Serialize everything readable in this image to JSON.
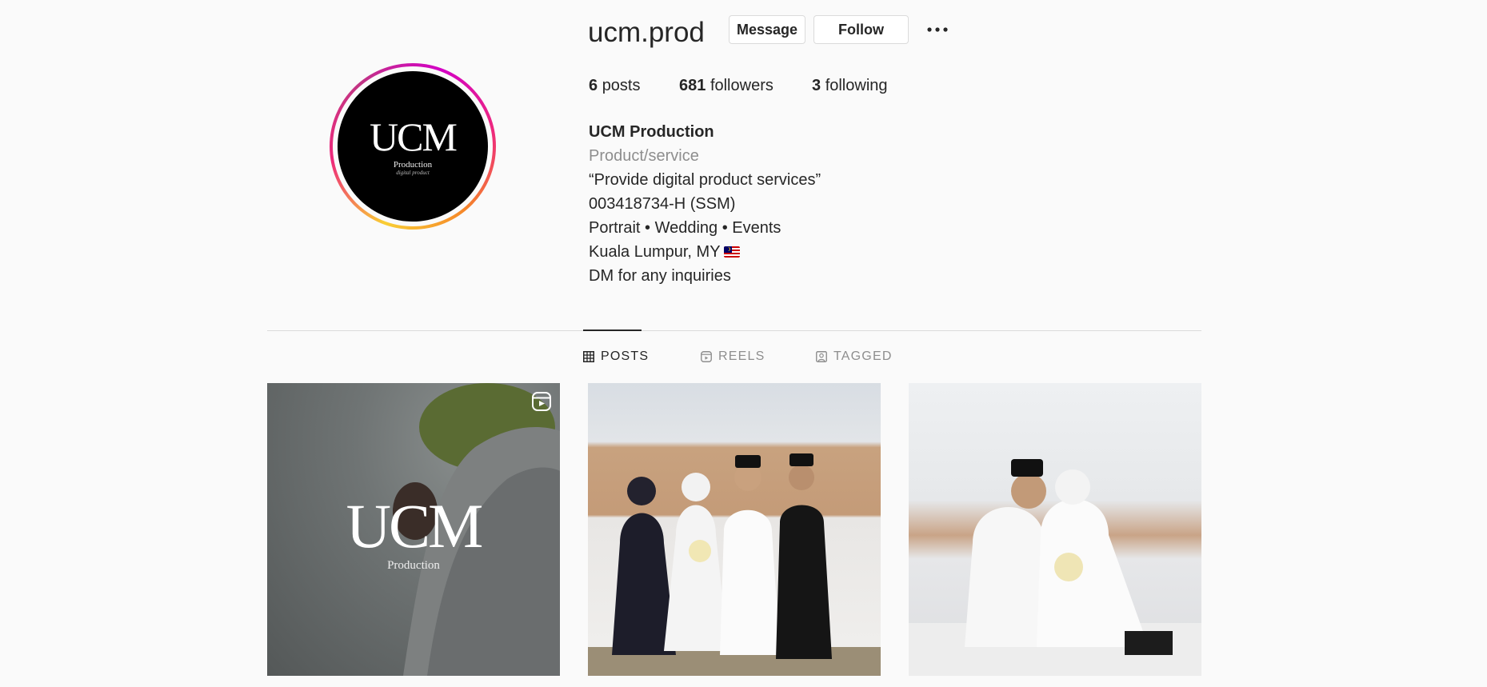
{
  "profile": {
    "username": "ucm.prod",
    "avatar": {
      "logo_main": "UCM",
      "logo_sub": "Production",
      "logo_script": "digital product"
    }
  },
  "actions": {
    "message_label": "Message",
    "follow_label": "Follow",
    "more_icon": "more-horizontal-icon"
  },
  "stats": {
    "posts_count": "6",
    "posts_label": "posts",
    "followers_count": "681",
    "followers_label": "followers",
    "following_count": "3",
    "following_label": "following"
  },
  "bio": {
    "name": "UCM Production",
    "category": "Product/service",
    "lines": [
      "“Provide digital product services”",
      "003418734-H (SSM)",
      "Portrait • Wedding • Events",
      "Kuala Lumpur, MY",
      "DM for any inquiries"
    ],
    "flag_icon": "malaysia-flag-icon"
  },
  "tabs": [
    {
      "label": "POSTS",
      "icon": "grid-icon",
      "active": true
    },
    {
      "label": "REELS",
      "icon": "reels-icon",
      "active": false
    },
    {
      "label": "TAGGED",
      "icon": "tagged-icon",
      "active": false
    }
  ],
  "posts": [
    {
      "overlay_text": "UCM",
      "overlay_sub": "Production",
      "type_icon": "reel-icon"
    },
    {
      "description_icon": "photo-icon"
    },
    {
      "description_icon": "photo-icon"
    }
  ],
  "colors": {
    "text": "#262626",
    "muted": "#8e8e8e",
    "border": "#dbdbdb",
    "background": "#fafafa"
  }
}
